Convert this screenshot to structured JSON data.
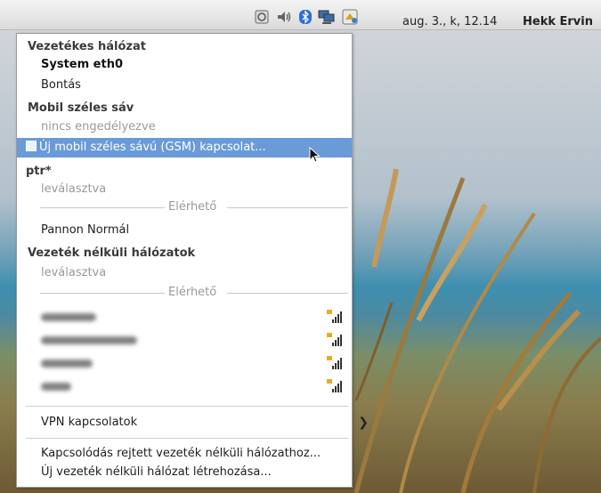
{
  "panel": {
    "tray_icons": [
      "sensor-icon",
      "volume-icon",
      "bluetooth-icon",
      "network-icon",
      "updates-icon"
    ],
    "clock": "aug. 3., k, 12.14",
    "user": "Hekk Ervin"
  },
  "menu": {
    "wired_header": "Vezetékes hálózat",
    "wired_connection": "System eth0",
    "wired_disconnect": "Bontás",
    "mobile_header": "Mobil széles sáv",
    "mobile_status": "nincs engedélyezve",
    "mobile_new": "Új mobil széles sávú (GSM) kapcsolat...",
    "ptr_header": "ptr*",
    "ptr_status": "leválasztva",
    "available_label": "Elérhető",
    "pannon": "Pannon Normál",
    "wireless_header": "Vezeték nélküli hálózatok",
    "wireless_status": "leválasztva",
    "wireless_available_label": "Elérhető",
    "networks": [
      "",
      "",
      "",
      ""
    ],
    "vpn": "VPN kapcsolatok",
    "connect_hidden": "Kapcsolódás rejtett vezeték nélküli hálózathoz...",
    "create_new": "Új vezeték nélküli hálózat létrehozása..."
  }
}
